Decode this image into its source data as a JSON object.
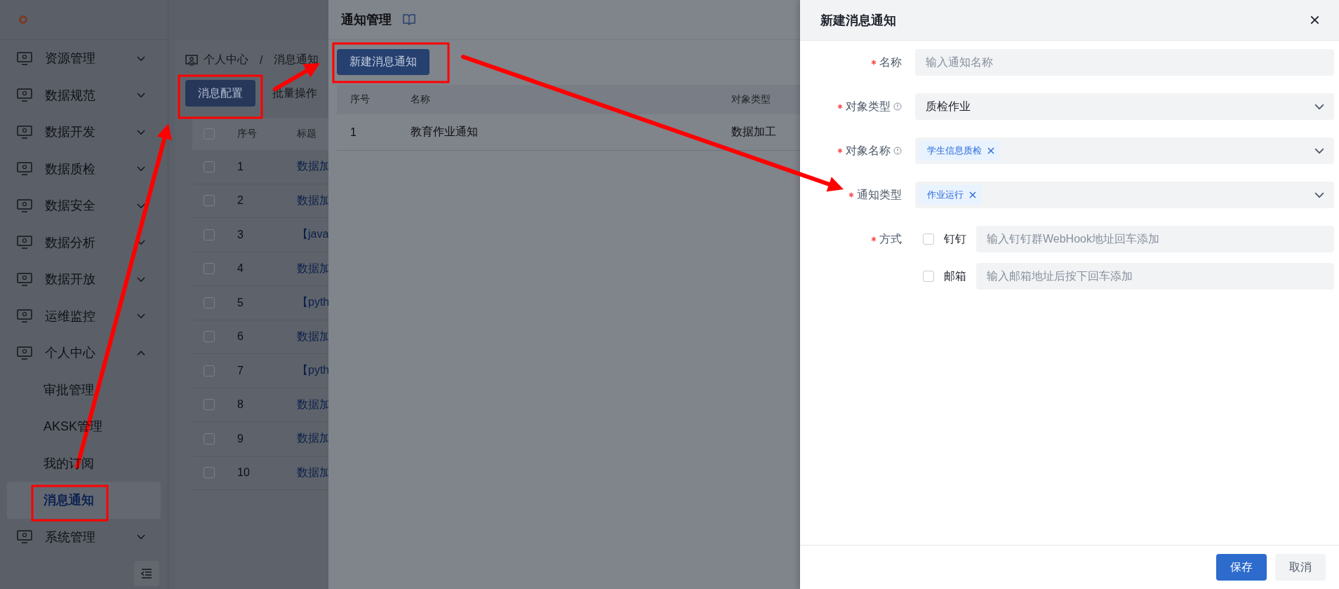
{
  "sidebar": {
    "items": [
      {
        "label": "资源管理",
        "expanded": false
      },
      {
        "label": "数据规范",
        "expanded": false
      },
      {
        "label": "数据开发",
        "expanded": false
      },
      {
        "label": "数据质检",
        "expanded": false
      },
      {
        "label": "数据安全",
        "expanded": false
      },
      {
        "label": "数据分析",
        "expanded": false
      },
      {
        "label": "数据开放",
        "expanded": false
      },
      {
        "label": "运维监控",
        "expanded": false
      },
      {
        "label": "个人中心",
        "expanded": true,
        "children": [
          {
            "label": "审批管理",
            "selected": false
          },
          {
            "label": "AKSK管理",
            "selected": false
          },
          {
            "label": "我的订阅",
            "selected": false
          },
          {
            "label": "消息通知",
            "selected": true
          }
        ]
      },
      {
        "label": "系统管理",
        "expanded": false
      }
    ]
  },
  "main": {
    "breadcrumb": {
      "separator": "/",
      "items": [
        "个人中心",
        "消息通知"
      ]
    },
    "buttons": [
      {
        "label": "消息配置",
        "kind": "primary"
      },
      {
        "label": "批量操作",
        "kind": "plain"
      }
    ],
    "table": {
      "header_checked": false,
      "columns": [
        "序号",
        "标题"
      ],
      "rows": [
        {
          "checked": false,
          "cells": [
            "1",
            "数据加"
          ]
        },
        {
          "checked": false,
          "cells": [
            "2",
            "数据加"
          ]
        },
        {
          "checked": false,
          "cells": [
            "3",
            "【java"
          ]
        },
        {
          "checked": false,
          "cells": [
            "4",
            "数据加"
          ]
        },
        {
          "checked": false,
          "cells": [
            "5",
            "【pyth"
          ]
        },
        {
          "checked": false,
          "cells": [
            "6",
            "数据加"
          ]
        },
        {
          "checked": false,
          "cells": [
            "7",
            "【pyth"
          ]
        },
        {
          "checked": false,
          "cells": [
            "8",
            "数据加"
          ]
        },
        {
          "checked": false,
          "cells": [
            "9",
            "数据加"
          ]
        },
        {
          "checked": false,
          "cells": [
            "10",
            "数据加"
          ]
        }
      ]
    }
  },
  "panel": {
    "title": "通知管理",
    "button": "新建消息通知",
    "table": {
      "columns": [
        "序号",
        "名称",
        "对象类型"
      ],
      "rows": [
        [
          "1",
          "教育作业通知",
          "数据加工"
        ]
      ]
    }
  },
  "drawer": {
    "title": "新建消息通知",
    "fields": [
      {
        "kind": "input",
        "label": "名称",
        "required": true,
        "info": false,
        "placeholder": "输入通知名称"
      },
      {
        "kind": "select",
        "label": "对象类型",
        "required": true,
        "info": true,
        "value": "质检作业"
      },
      {
        "kind": "tags",
        "label": "对象名称",
        "required": true,
        "info": true,
        "tags": [
          "学生信息质检"
        ]
      },
      {
        "kind": "tags",
        "label": "通知类型",
        "required": true,
        "info": false,
        "tags": [
          "作业运行"
        ]
      },
      {
        "kind": "channels",
        "label": "方式",
        "required": true,
        "info": false,
        "options": [
          {
            "label": "钉钉",
            "checked": false,
            "placeholder": "输入钉钉群WebHook地址回车添加"
          },
          {
            "label": "邮箱",
            "checked": false,
            "placeholder": "输入邮箱地址后按下回车添加"
          }
        ]
      }
    ],
    "buttons": [
      {
        "label": "保存",
        "kind": "primary"
      },
      {
        "label": "取消",
        "kind": "plain"
      }
    ]
  }
}
